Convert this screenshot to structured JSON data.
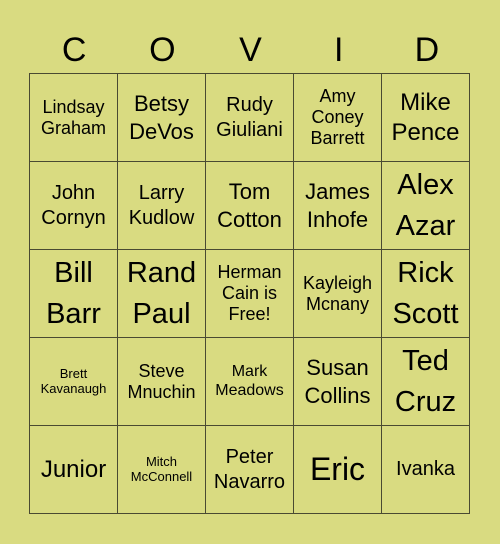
{
  "header": [
    "C",
    "O",
    "V",
    "I",
    "D"
  ],
  "cells": [
    "Lindsay Graham",
    "Betsy DeVos",
    "Rudy Giuliani",
    "Amy Coney Barrett",
    "Mike Pence",
    "John Cornyn",
    "Larry Kudlow",
    "Tom Cotton",
    "James Inhofe",
    "Alex Azar",
    "Bill Barr",
    "Rand Paul",
    "Herman Cain is Free!",
    "Kayleigh Mcnany",
    "Rick Scott",
    "Brett Kavanaugh",
    "Steve Mnuchin",
    "Mark Meadows",
    "Susan Collins",
    "Ted Cruz",
    "Junior",
    "Mitch McConnell",
    "Peter Navarro",
    "Eric",
    "Ivanka"
  ],
  "theme": {
    "background": "#d9db81",
    "grid_line": "#4a4a32",
    "text": "#000000"
  }
}
